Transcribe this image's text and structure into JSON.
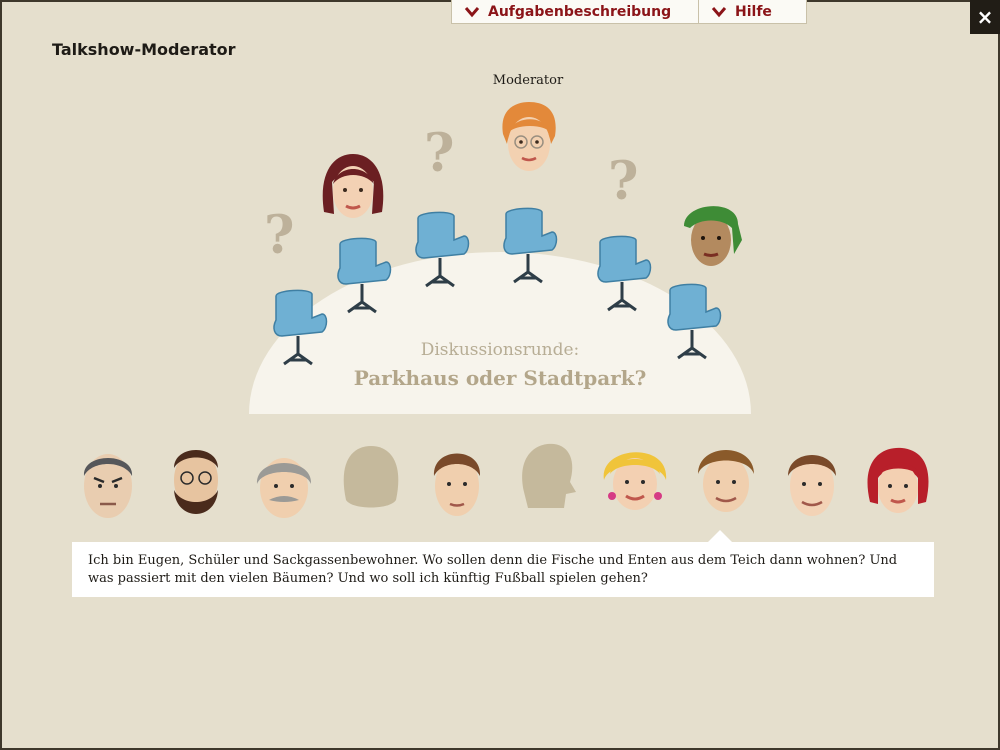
{
  "header": {
    "tab_task": "Aufgabenbeschreibung",
    "tab_help": "Hilfe",
    "close": "×"
  },
  "page": {
    "title": "Talkshow-Moderator"
  },
  "stage": {
    "moderator_label": "Moderator",
    "topic_label": "Diskussionsrunde:",
    "topic_title": "Parkhaus oder Stadtpark?",
    "question_mark": "?"
  },
  "speech": {
    "text": "Ich bin Eugen, Schüler und Sackgassenbewohner. Wo sollen denn die Fische und Enten aus dem Teich dann wohnen? Und was passiert mit den vielen Bäumen? Und wo soll ich künftig Fußball spielen gehen?"
  },
  "colors": {
    "background": "#e5dfcd",
    "stage": "#f7f4ec",
    "chair": "#6fb0d3",
    "accent_red": "#8b1418",
    "faded": "#bdb19a"
  }
}
